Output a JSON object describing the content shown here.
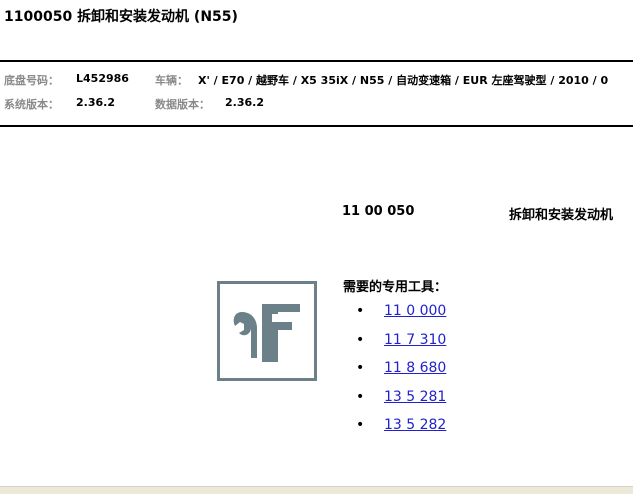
{
  "document": {
    "title": "1100050 拆卸和安装发动机 (N55)"
  },
  "meta": {
    "chassis_label": "底盘号码：",
    "chassis_value": "L452986",
    "vehicle_label": "车辆：",
    "vehicle_value": "X' / E70 / 越野车 / X5 35iX / N55 / 自动变速箱 / EUR 左座驾驶型 / 2010 / 0",
    "system_version_label": "系统版本：",
    "system_version_value": "2.36.2",
    "data_version_label": "数据版本：",
    "data_version_value": "2.36.2"
  },
  "procedure": {
    "number": "11 00 050",
    "title": "拆卸和安装发动机"
  },
  "special_tools": {
    "heading": "需要的专用工具：",
    "icon": "wrench-caliper-icon",
    "bullet": "•",
    "items": [
      {
        "label": "11 0 000"
      },
      {
        "label": "11 7 310"
      },
      {
        "label": "11 8 680"
      },
      {
        "label": "13 5 281"
      },
      {
        "label": "13 5 282"
      }
    ]
  },
  "colors": {
    "link": "#2222cc",
    "label_grey": "#8a8a8a",
    "icon_slate": "#6b8088"
  }
}
